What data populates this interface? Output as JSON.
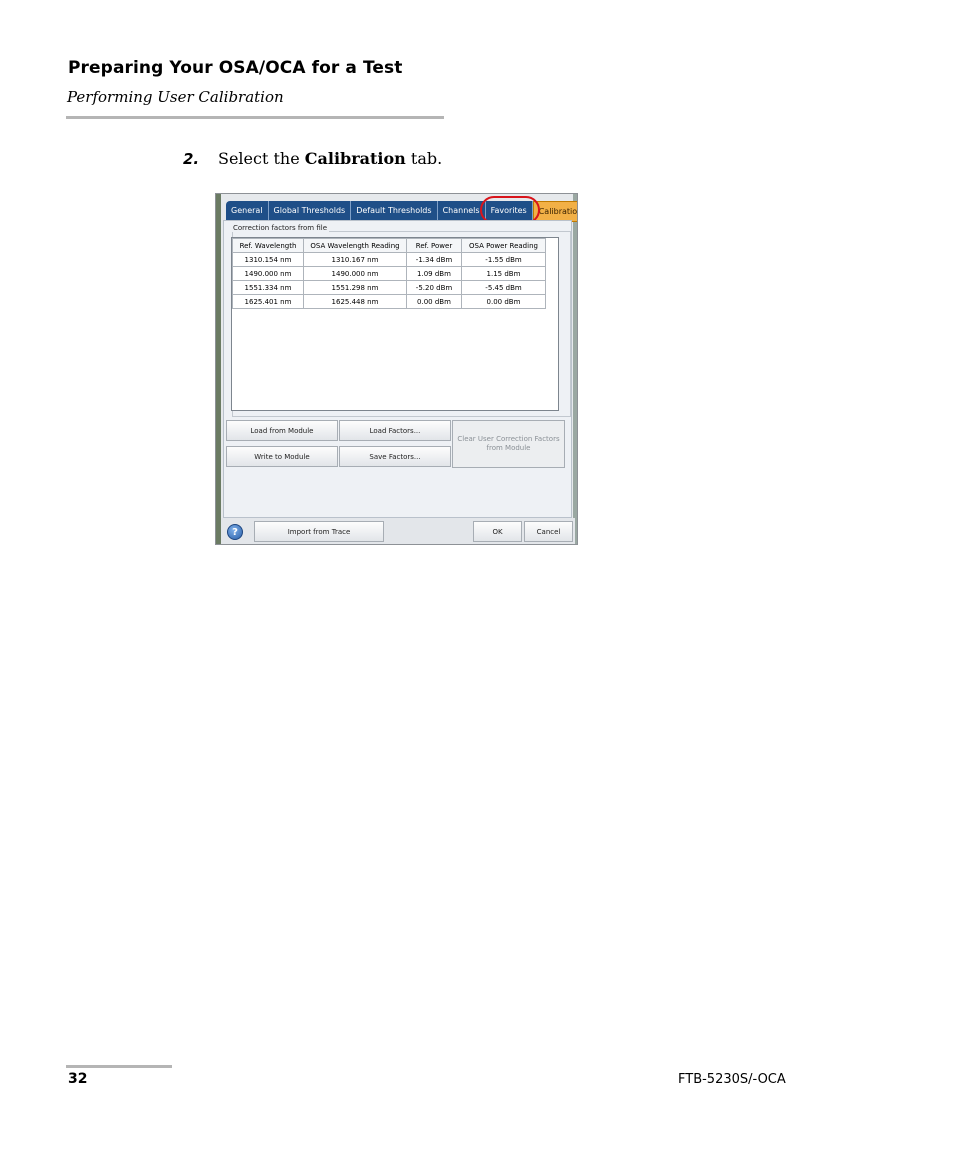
{
  "header": {
    "title": "Preparing Your OSA/OCA for a Test",
    "subtitle": "Performing User Calibration"
  },
  "step": {
    "number": "2.",
    "text_before": "Select the ",
    "bold": "Calibration",
    "text_after": " tab."
  },
  "dialog": {
    "tabs": [
      "General",
      "Global Thresholds",
      "Default Thresholds",
      "Channels",
      "Favorites",
      "Calibration"
    ],
    "active_tab": "Calibration",
    "group_label": "Correction factors from file",
    "table": {
      "headers": [
        "Ref. Wavelength",
        "OSA Wavelength Reading",
        "Ref. Power",
        "OSA Power Reading"
      ],
      "rows": [
        [
          "1310.154 nm",
          "1310.167 nm",
          "-1.34 dBm",
          "-1.55 dBm"
        ],
        [
          "1490.000 nm",
          "1490.000 nm",
          "1.09 dBm",
          "1.15 dBm"
        ],
        [
          "1551.334 nm",
          "1551.298 nm",
          "-5.20 dBm",
          "-5.45 dBm"
        ],
        [
          "1625.401 nm",
          "1625.448 nm",
          "0.00 dBm",
          "0.00 dBm"
        ]
      ]
    },
    "buttons": {
      "load_from_module": "Load from Module",
      "load_factors": "Load Factors...",
      "clear_factors_line1": "Clear User Correction Factors",
      "clear_factors_line2": "from Module",
      "write_to_module": "Write to Module",
      "save_factors": "Save Factors...",
      "help": "?",
      "import_from_trace": "Import from Trace",
      "ok": "OK",
      "cancel": "Cancel"
    },
    "colors": {
      "tab_blue": "#1f4f88",
      "tab_active": "#f2b046",
      "highlight_circle": "#d9141b"
    }
  },
  "footer": {
    "page_number": "32",
    "document_id": "FTB-5230S/-OCA"
  }
}
